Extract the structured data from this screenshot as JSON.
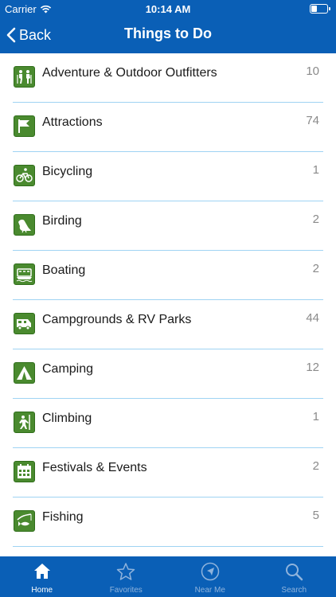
{
  "status_bar": {
    "carrier": "Carrier",
    "time": "10:14 AM"
  },
  "nav": {
    "back_label": "Back",
    "title": "Things to Do"
  },
  "colors": {
    "brand_blue": "#0a5fb6",
    "icon_green": "#4a8a2f",
    "separator": "#9fd3f3"
  },
  "items": [
    {
      "label": "Adventure & Outdoor Outfitters",
      "count": "10",
      "icon": "hikers-icon"
    },
    {
      "label": "Attractions",
      "count": "74",
      "icon": "flag-icon"
    },
    {
      "label": "Bicycling",
      "count": "1",
      "icon": "bicycle-icon"
    },
    {
      "label": "Birding",
      "count": "2",
      "icon": "bird-icon"
    },
    {
      "label": "Boating",
      "count": "2",
      "icon": "boat-icon"
    },
    {
      "label": "Campgrounds & RV Parks",
      "count": "44",
      "icon": "rv-icon"
    },
    {
      "label": "Camping",
      "count": "12",
      "icon": "tent-icon"
    },
    {
      "label": "Climbing",
      "count": "1",
      "icon": "climber-icon"
    },
    {
      "label": "Festivals & Events",
      "count": "2",
      "icon": "calendar-icon"
    },
    {
      "label": "Fishing",
      "count": "5",
      "icon": "fishing-icon"
    }
  ],
  "tabs": [
    {
      "label": "Home",
      "icon": "home-icon",
      "active": true
    },
    {
      "label": "Favorites",
      "icon": "star-icon",
      "active": false
    },
    {
      "label": "Near Me",
      "icon": "location-arrow-icon",
      "active": false
    },
    {
      "label": "Search",
      "icon": "search-icon",
      "active": false
    }
  ]
}
